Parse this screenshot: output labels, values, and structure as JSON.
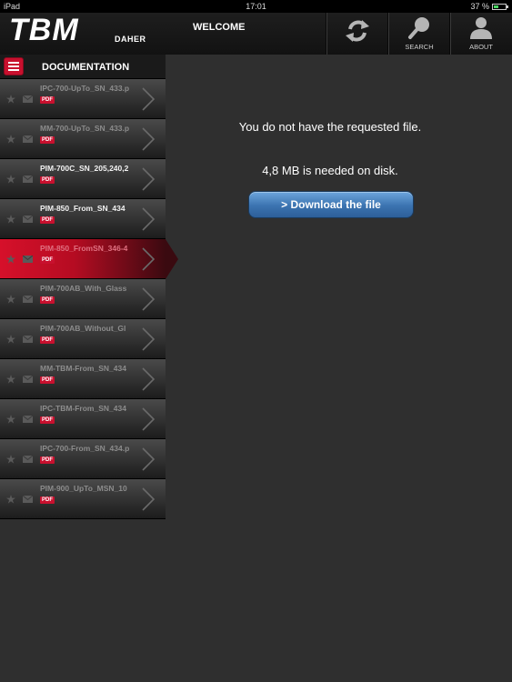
{
  "status_bar": {
    "device": "iPad",
    "time": "17:01",
    "battery": "37 %",
    "battery_level": 0.37
  },
  "header": {
    "logo_main": "TBM",
    "logo_sub": "DAHER",
    "title": "WELCOME",
    "buttons": [
      {
        "icon": "refresh-icon",
        "label": ""
      },
      {
        "icon": "search-icon",
        "label": "SEARCH"
      },
      {
        "icon": "person-icon",
        "label": "ABOUT"
      }
    ]
  },
  "sidebar": {
    "title": "DOCUMENTATION",
    "items": [
      {
        "name": "IPC-700-UpTo_SN_433.p",
        "badge": "PDF",
        "state": "dim"
      },
      {
        "name": "MM-700-UpTo_SN_433.p",
        "badge": "PDF",
        "state": "dim"
      },
      {
        "name": "PIM-700C_SN_205,240,2",
        "badge": "PDF",
        "state": "bright"
      },
      {
        "name": "PIM-850_From_SN_434",
        "badge": "PDF",
        "state": "bright"
      },
      {
        "name": "PIM-850_FromSN_346-4",
        "badge": "PDF",
        "state": "active"
      },
      {
        "name": "PIM-700AB_With_Glass",
        "badge": "PDF",
        "state": "dim"
      },
      {
        "name": "PIM-700AB_Without_Gl",
        "badge": "PDF",
        "state": "dim"
      },
      {
        "name": "MM-TBM-From_SN_434",
        "badge": "PDF",
        "state": "dim"
      },
      {
        "name": "IPC-TBM-From_SN_434",
        "badge": "PDF",
        "state": "dim"
      },
      {
        "name": "IPC-700-From_SN_434.p",
        "badge": "PDF",
        "state": "dim"
      },
      {
        "name": "PIM-900_UpTo_MSN_10",
        "badge": "PDF",
        "state": "dim"
      }
    ]
  },
  "main": {
    "message": "You do not have the requested file.",
    "space_needed": "4,8 MB is needed on disk.",
    "download_button": "> Download the file"
  },
  "colors": {
    "accent_red": "#c8102e",
    "button_blue": "#3b73b0"
  }
}
